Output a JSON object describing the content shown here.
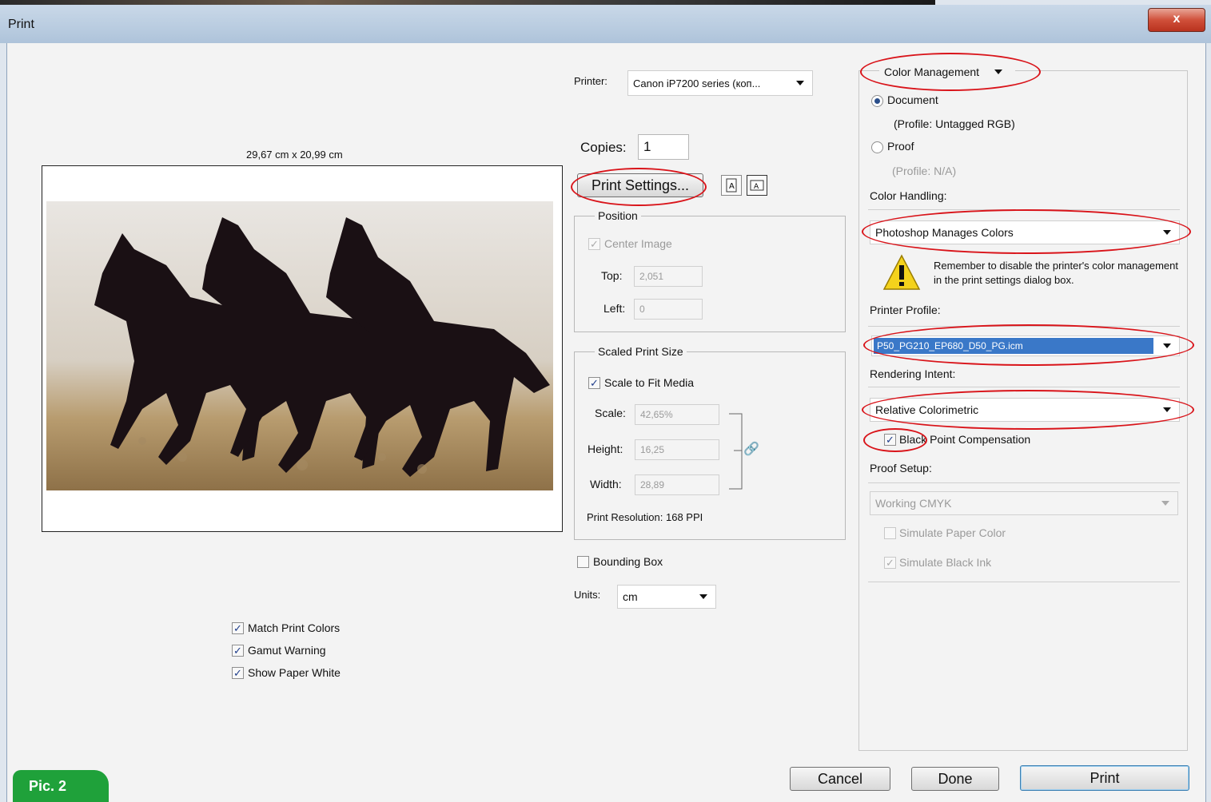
{
  "window": {
    "title": "Print",
    "close_label": "x"
  },
  "preview": {
    "size_label": "29,67 cm x 20,99 cm"
  },
  "printer": {
    "label": "Printer:",
    "value": "Canon iP7200 series (кoп..."
  },
  "copies": {
    "label": "Copies:",
    "value": "1"
  },
  "print_settings": {
    "label": "Print Settings..."
  },
  "position": {
    "legend": "Position",
    "center_image": {
      "label": "Center Image",
      "checked": true
    },
    "top": {
      "label": "Top:",
      "value": "2,051"
    },
    "left": {
      "label": "Left:",
      "value": "0"
    }
  },
  "scaled": {
    "legend": "Scaled Print Size",
    "scale_to_fit": {
      "label": "Scale to Fit Media",
      "checked": true
    },
    "scale": {
      "label": "Scale:",
      "value": "42,65%"
    },
    "height": {
      "label": "Height:",
      "value": "16,25"
    },
    "width": {
      "label": "Width:",
      "value": "28,89"
    },
    "resolution": "Print Resolution: 168 PPI"
  },
  "bounding_box": {
    "label": "Bounding Box",
    "checked": false
  },
  "units": {
    "label": "Units:",
    "value": "cm"
  },
  "preview_options": [
    {
      "label": "Match Print Colors",
      "checked": true
    },
    {
      "label": "Gamut Warning",
      "checked": true
    },
    {
      "label": "Show Paper White",
      "checked": true
    }
  ],
  "color_mgmt": {
    "section": "Color Management",
    "document": {
      "label": "Document",
      "profile": "(Profile: Untagged RGB)"
    },
    "proof": {
      "label": "Proof",
      "profile": "(Profile: N/A)"
    },
    "handling_label": "Color Handling:",
    "handling_value": "Photoshop Manages Colors",
    "warning": "Remember to disable the printer's color management in the print settings dialog box.",
    "printer_profile_label": "Printer Profile:",
    "printer_profile_value": "P50_PG210_EP680_D50_PG.icm",
    "rendering_label": "Rendering Intent:",
    "rendering_value": "Relative Colorimetric",
    "bpc_label": "Black Point Compensation",
    "proof_setup_label": "Proof Setup:",
    "proof_setup_value": "Working CMYK",
    "simulate_paper": "Simulate Paper Color",
    "simulate_ink": "Simulate Black Ink"
  },
  "buttons": {
    "cancel": "Cancel",
    "done": "Done",
    "print": "Print"
  },
  "badge": "Pic. 2",
  "colors": {
    "highlight": "#3a78c8",
    "annotation": "#d9141a",
    "badge": "#1fa13a"
  }
}
